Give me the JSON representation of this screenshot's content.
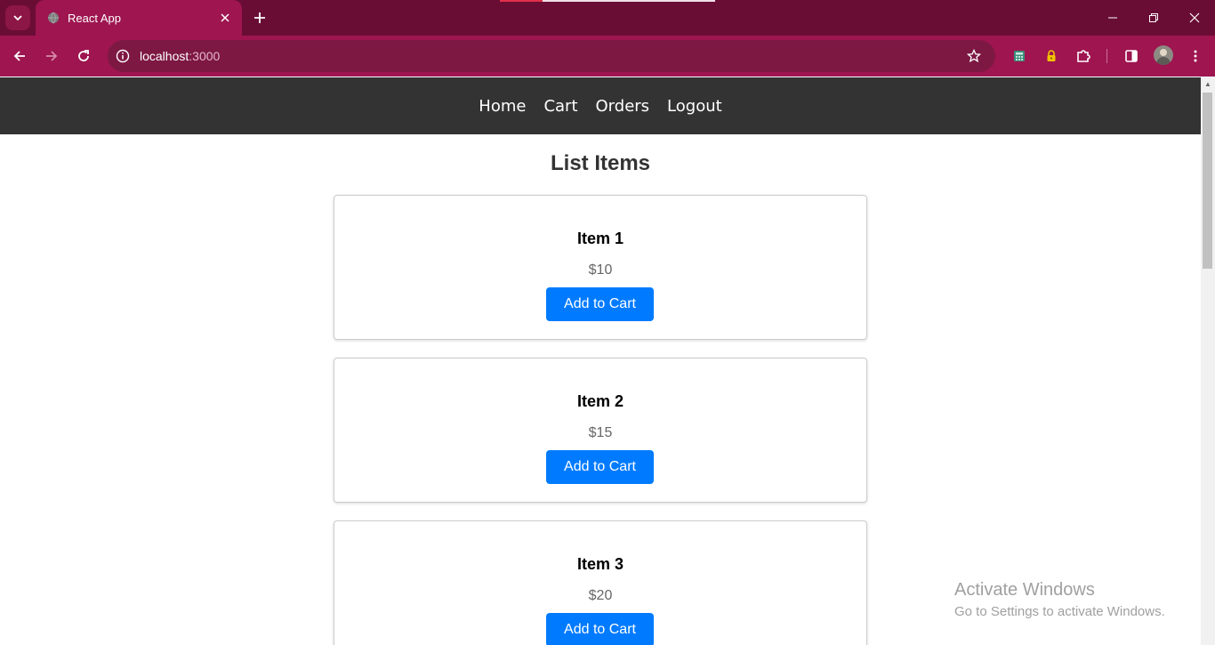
{
  "browser": {
    "tab_title": "React App",
    "url_host": "localhost",
    "url_port": ":3000",
    "theme_color": "#9e1550"
  },
  "nav": {
    "links": [
      "Home",
      "Cart",
      "Orders",
      "Logout"
    ]
  },
  "page": {
    "title": "List Items"
  },
  "items": [
    {
      "name": "Item 1",
      "price": "$10",
      "button_label": "Add to Cart"
    },
    {
      "name": "Item 2",
      "price": "$15",
      "button_label": "Add to Cart"
    },
    {
      "name": "Item 3",
      "price": "$20",
      "button_label": "Add to Cart"
    }
  ],
  "watermark": {
    "line1": "Activate Windows",
    "line2": "Go to Settings to activate Windows."
  },
  "colors": {
    "navbar_bg": "#333333",
    "button_bg": "#007bff"
  },
  "icons": {
    "tab_search": "chevron-down-icon",
    "tab_close": "close-icon",
    "new_tab": "plus-icon",
    "back": "arrow-left-icon",
    "forward": "arrow-right-icon",
    "reload": "reload-icon",
    "site_info": "info-icon",
    "bookmark": "star-icon",
    "extensions": "puzzle-icon",
    "side_panel": "side-panel-icon",
    "menu": "more-vertical-icon"
  }
}
